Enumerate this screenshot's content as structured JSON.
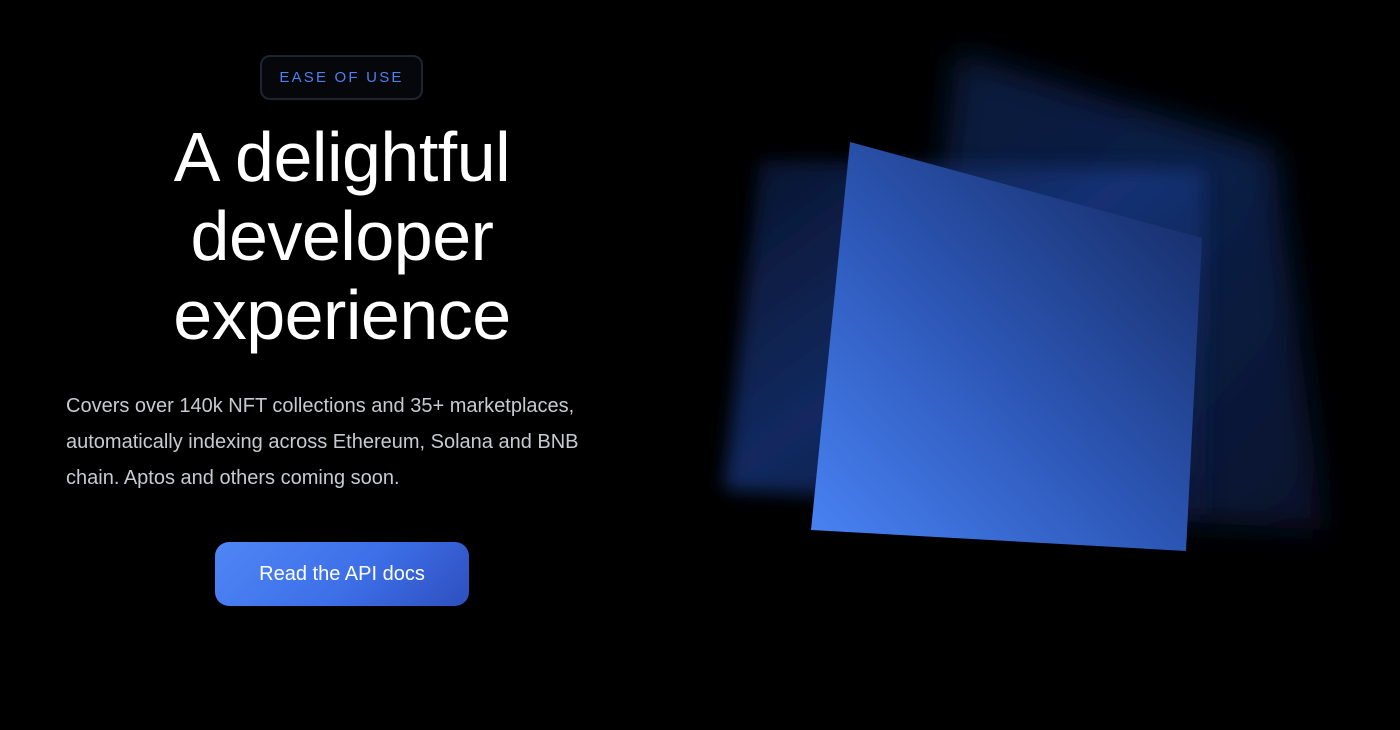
{
  "hero": {
    "badge": "EASE OF USE",
    "headline_lines": [
      "A delightful",
      "developer",
      "experience"
    ],
    "description_lines": [
      "Covers over 140k NFT collections and 35+ marketplaces,",
      "automatically indexing across Ethereum, Solana and BNB",
      "chain. Aptos and others coming soon."
    ],
    "cta_label": "Read the API docs"
  },
  "art": {
    "icon": "stacked-blue-panels-illustration"
  },
  "colors": {
    "background": "#000000",
    "accent": "#4f7ff0",
    "heading": "#ffffff",
    "body_text": "#c7cad1",
    "badge_border": "#1f2530",
    "button_start": "#4f86f5",
    "button_end": "#2e4fbe"
  }
}
